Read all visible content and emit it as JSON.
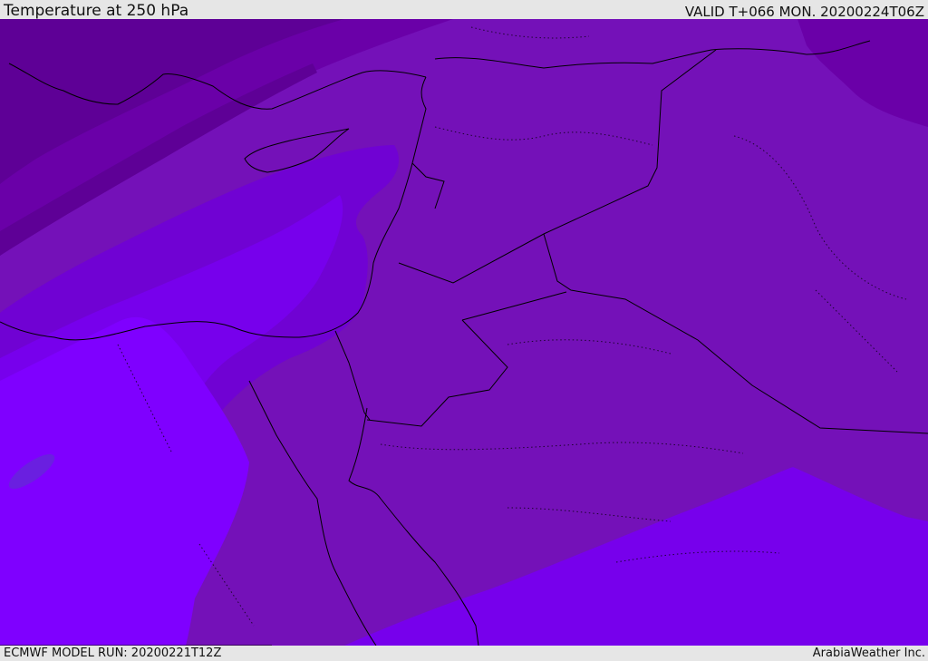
{
  "header": {
    "title": "Temperature at 250 hPa",
    "valid_time": "VALID T+066 MON. 20200224T06Z"
  },
  "footer": {
    "model_run": "ECMWF MODEL RUN: 20200221T12Z",
    "credit": "ArabiaWeather Inc."
  },
  "map": {
    "field": "temperature",
    "level": "250 hPa",
    "legend": "none",
    "colors": {
      "band_coldest": "#5e0096",
      "band_cold": "#6a00a8",
      "band_mid": "#7411b8",
      "band_mid_warm": "#7002d3",
      "band_warm": "#7700ec",
      "band_warmest": "#7f00ff",
      "coastline": "#000000",
      "border": "#000000"
    }
  }
}
